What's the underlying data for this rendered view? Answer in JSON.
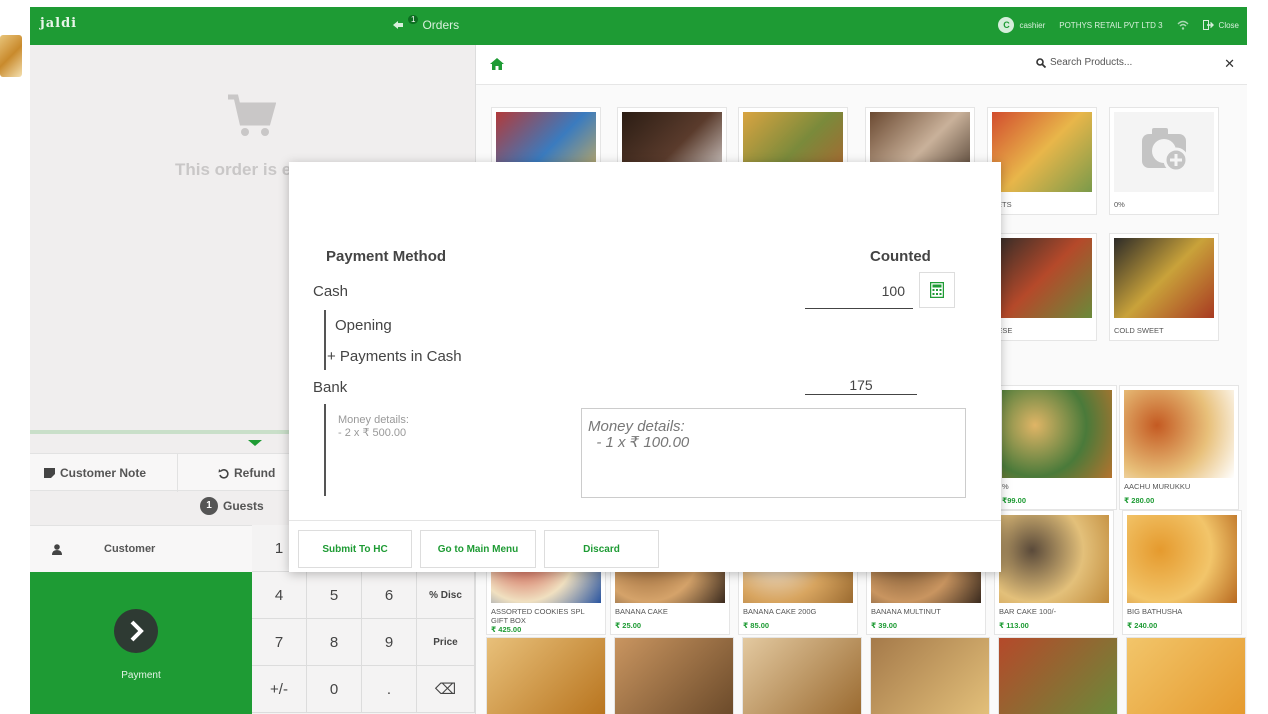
{
  "topbar": {
    "logo": "jaldi",
    "orders_label": "Orders",
    "orders_count": "1",
    "cashier_initial": "C",
    "cashier": "cashier",
    "company": "POTHYS RETAIL PVT LTD 3",
    "close_label": "Close"
  },
  "left": {
    "empty_text": "This order is e",
    "customer_note": "Customer Note",
    "refund": "Refund",
    "guests_count": "1",
    "guests_label": "Guests",
    "customer": "Customer",
    "payment": "Payment"
  },
  "numpad": [
    "1",
    "",
    "",
    "",
    "4",
    "5",
    "6",
    "% Disc",
    "7",
    "8",
    "9",
    "Price",
    "+/-",
    "0",
    ".",
    "⌫"
  ],
  "search": {
    "placeholder": "Search Products..."
  },
  "categories": [
    {
      "label": "",
      "colors": [
        "#b23a3a",
        "#3a7bbf",
        "#e3b54b"
      ]
    },
    {
      "label": "",
      "colors": [
        "#2b1d14",
        "#5a3b2c",
        "#eee"
      ]
    },
    {
      "label": "",
      "colors": [
        "#d9a441",
        "#7a8a3b",
        "#b55d2e"
      ]
    },
    {
      "label": "",
      "colors": [
        "#6b4a32",
        "#c9b19a",
        "#3a2a1e"
      ]
    },
    {
      "label": "EETS",
      "colors": [
        "#d24d2e",
        "#e8b64a",
        "#7a9a4a"
      ]
    },
    {
      "label": "0%",
      "colors": [
        "#ffffff"
      ]
    },
    {
      "label": "NESE",
      "colors": [
        "#2d2b28",
        "#b5492a",
        "#6a8a3a"
      ]
    },
    {
      "label": "COLD SWEET",
      "colors": [
        "#2d2b28",
        "#c9a23a",
        "#a83a22"
      ]
    }
  ],
  "products": [
    {
      "name": "%",
      "price": "₹99.00",
      "colors": [
        "#e0b566",
        "#4a7a3a",
        "#b5732e"
      ]
    },
    {
      "name": "AACHU MURUKKU",
      "price": "₹ 280.00",
      "colors": [
        "#c45a22",
        "#e8c07a",
        "#fff"
      ]
    },
    {
      "name": "ASSORTED COOKIES SPL GIFT BOX",
      "price": "₹ 425.00",
      "colors": [
        "#c6362e",
        "#f0e0c0",
        "#2a55a0"
      ]
    },
    {
      "name": "BANANA CAKE",
      "price": "₹ 25.00",
      "colors": [
        "#8a5a2e",
        "#d5a36a",
        "#3a2a1e"
      ]
    },
    {
      "name": "BANANA CAKE 200G",
      "price": "₹ 85.00",
      "colors": [
        "#f0f0f0",
        "#d8a560",
        "#9a6a30"
      ]
    },
    {
      "name": "BANANA MULTINUT",
      "price": "₹ 39.00",
      "colors": [
        "#6b4a2a",
        "#c99560",
        "#3a2a1e"
      ]
    },
    {
      "name": "BAR CAKE 100/-",
      "price": "₹ 113.00",
      "colors": [
        "#5a4a3a",
        "#e3c07a",
        "#c08a3a"
      ]
    },
    {
      "name": "BIG BATHUSHA",
      "price": "₹ 240.00",
      "colors": [
        "#e59a2e",
        "#f2c56a",
        "#b86a20"
      ]
    }
  ],
  "modal": {
    "payment_method": "Payment Method",
    "counted": "Counted",
    "cash": "Cash",
    "cash_counted": "100",
    "opening": "Opening",
    "payments_in_cash": "+ Payments in Cash",
    "bank": "Bank",
    "bank_counted": "175",
    "money_details_left_1": "Money details:",
    "money_details_left_2": "- 2 x ₹ 500.00",
    "money_details_box": "Money details:\n  - 1 x ₹ 100.00",
    "submit": "Submit To HC",
    "main_menu": "Go to Main Menu",
    "discard": "Discard"
  }
}
